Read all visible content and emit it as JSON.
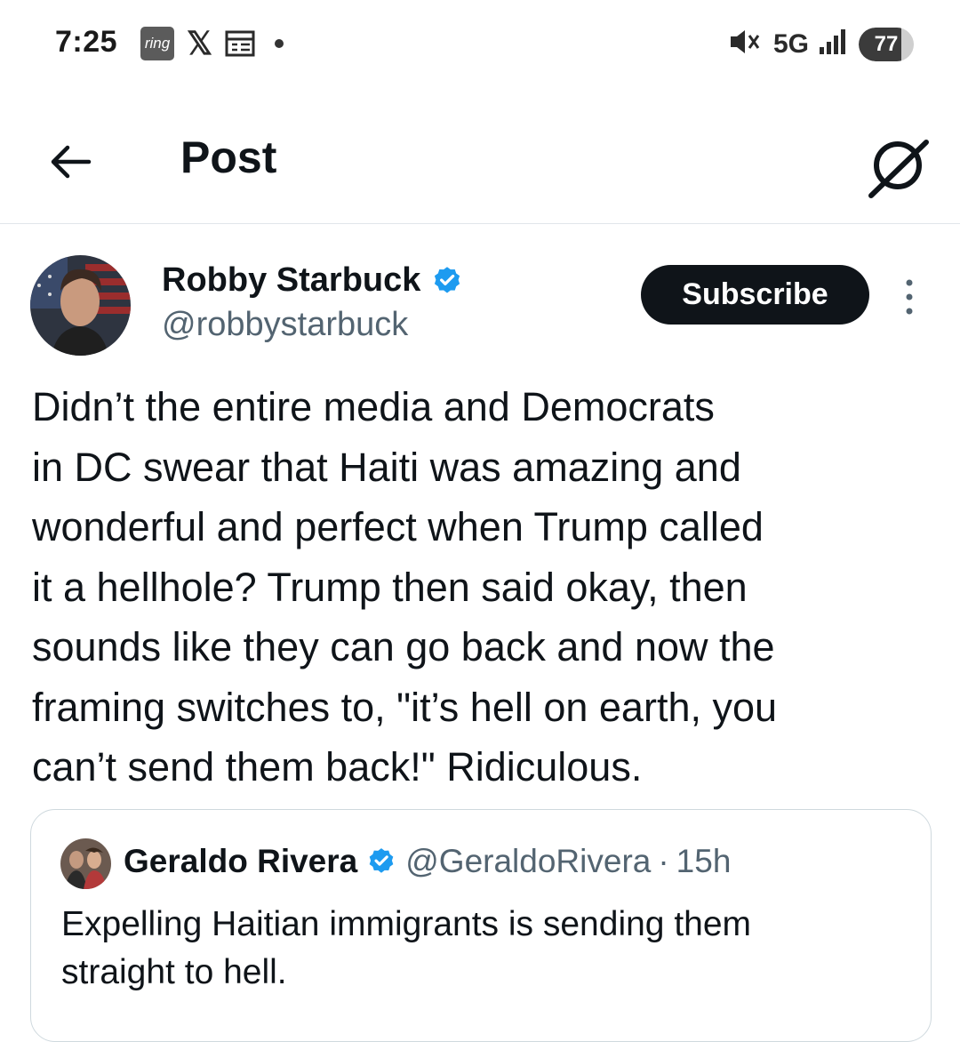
{
  "status_bar": {
    "time": "7:25",
    "ring_label": "ring",
    "network_label": "5G",
    "battery_level": 77,
    "battery_text": "77",
    "icons": [
      "ring-icon",
      "x-logo-icon",
      "news-icon",
      "notification-dot-icon",
      "mute-icon",
      "signal-icon"
    ]
  },
  "header": {
    "title": "Post",
    "back_icon": "arrow-left-icon",
    "grok_icon": "grok-icon"
  },
  "post": {
    "author_name": "Robby Starbuck",
    "handle": "@robbystarbuck",
    "verified": true,
    "subscribe_label": "Subscribe",
    "text_lines": [
      "Didn’t the entire media and Democrats",
      "in DC swear that Haiti was amazing and",
      "wonderful and perfect when Trump called",
      "it a hellhole? Trump then said okay, then",
      "sounds like they can go back and now the",
      "framing switches to, \"it’s hell on earth, you",
      "can’t send them back!\" Ridiculous."
    ]
  },
  "quote": {
    "author_name": "Geraldo Rivera",
    "handle": "@GeraldoRivera",
    "separator": "·",
    "time": "15h",
    "verified": true,
    "text_lines": [
      "Expelling Haitian immigrants is sending them",
      "straight to hell."
    ]
  },
  "colors": {
    "primary_text": "#0f1419",
    "secondary_text": "#536471",
    "verified_blue": "#1d9bf0",
    "button_bg": "#0f1419",
    "divider": "#e1e6ea"
  }
}
